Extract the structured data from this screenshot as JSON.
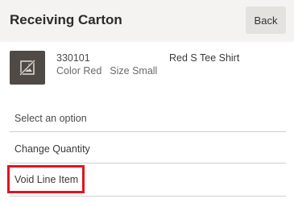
{
  "header": {
    "title": "Receiving Carton",
    "back_label": "Back"
  },
  "item": {
    "sku": "330101",
    "color": "Color Red",
    "size": "Size Small",
    "name": "Red S Tee Shirt",
    "thumbnail_icon": "image-unavailable-icon"
  },
  "options": {
    "prompt": "Select an option",
    "items": [
      {
        "label": "Change Quantity"
      },
      {
        "label": "Void Line Item",
        "highlighted": true
      }
    ]
  },
  "colors": {
    "header_bg": "#f4f3f1",
    "highlight_border": "#e0141e"
  }
}
